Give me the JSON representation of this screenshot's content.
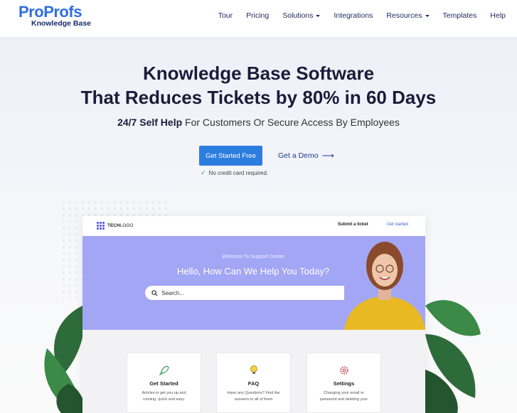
{
  "logo": {
    "brand_part1": "Pro",
    "brand_part2": "Profs",
    "subtitle": "Knowledge Base"
  },
  "nav": {
    "items": [
      {
        "label": "Tour",
        "dropdown": false
      },
      {
        "label": "Pricing",
        "dropdown": false
      },
      {
        "label": "Solutions",
        "dropdown": true
      },
      {
        "label": "Integrations",
        "dropdown": false
      },
      {
        "label": "Resources",
        "dropdown": true
      },
      {
        "label": "Templates",
        "dropdown": false
      },
      {
        "label": "Help",
        "dropdown": false
      }
    ]
  },
  "hero": {
    "title_line1": "Knowledge Base Software",
    "title_line2": "That Reduces Tickets by 80% in 60 Days",
    "tagline_bold": "24/7 Self Help",
    "tagline_rest": " For Customers Or Secure Access By Employees",
    "cta_primary": "Get Started Free",
    "cta_secondary": "Get a Demo",
    "no_card_note": "No credit card required."
  },
  "mock": {
    "logo_text_bold": "TECH",
    "logo_text_light": "LOGO",
    "submit_ticket": "Submit a ticket",
    "get_started": "Get started",
    "welcome": "Welcome To Support Center",
    "heading": "Hello, How Can We Help You Today?",
    "search_placeholder": "Search...",
    "cards": [
      {
        "icon": "rocket-icon",
        "title": "Get Started",
        "desc": "Articles to get you up and running, quick and easy."
      },
      {
        "icon": "lightbulb-icon",
        "title": "FAQ",
        "desc": "Have any Questions? Find the answers to all of them"
      },
      {
        "icon": "gear-icon",
        "title": "Settings",
        "desc": "Changing your email or password and deleting your"
      }
    ]
  },
  "colors": {
    "brand_blue": "#2f6fe0",
    "cta_blue": "#2c7de0",
    "banner_purple": "#a3a6f4",
    "navy": "#1b1c3a"
  }
}
